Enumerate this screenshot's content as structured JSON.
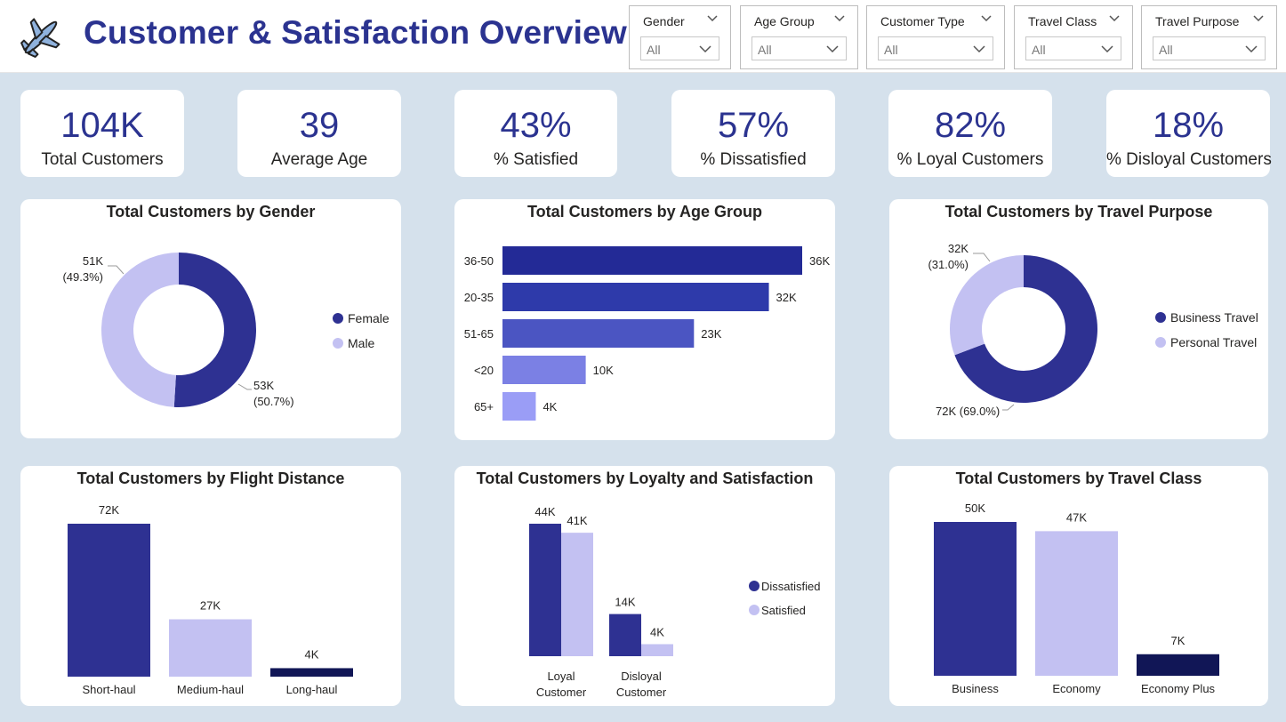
{
  "header": {
    "title": "Customer & Satisfaction Overview",
    "logo_icon": "airplane-icon"
  },
  "filters": [
    {
      "label": "Gender",
      "value": "All"
    },
    {
      "label": "Age Group",
      "value": "All"
    },
    {
      "label": "Customer Type",
      "value": "All"
    },
    {
      "label": "Travel Class",
      "value": "All"
    },
    {
      "label": "Travel Purpose",
      "value": "All"
    }
  ],
  "kpis": [
    {
      "value": "104K",
      "label": "Total Customers"
    },
    {
      "value": "39",
      "label": "Average Age"
    },
    {
      "value": "43%",
      "label": "% Satisfied"
    },
    {
      "value": "57%",
      "label": "% Dissatisfied"
    },
    {
      "value": "82%",
      "label": "% Loyal Customers"
    },
    {
      "value": "18%",
      "label": "% Disloyal Customers"
    }
  ],
  "colors": {
    "dark": "#2e3192",
    "light": "#c3c1f2",
    "navy": "#111656",
    "accent": "#2b3390"
  },
  "chart_data": [
    {
      "id": "gender",
      "type": "pie",
      "title": "Total Customers by Gender",
      "legend": "right",
      "slices": [
        {
          "name": "Female",
          "value": 53,
          "label": "53K",
          "pct": "(50.7%)",
          "color": "#2e3192"
        },
        {
          "name": "Male",
          "value": 51,
          "label": "51K",
          "pct": "(49.3%)",
          "color": "#c3c1f2"
        }
      ]
    },
    {
      "id": "age",
      "type": "bar",
      "orientation": "horizontal",
      "title": "Total Customers by Age Group",
      "categories": [
        "36-50",
        "20-35",
        "51-65",
        "<20",
        "65+"
      ],
      "values": [
        36,
        32,
        23,
        10,
        4
      ],
      "labels": [
        "36K",
        "32K",
        "23K",
        "10K",
        "4K"
      ],
      "colors": [
        "#232a96",
        "#2e3aaa",
        "#4b55c2",
        "#7b80e4",
        "#9a9df6"
      ]
    },
    {
      "id": "purpose",
      "type": "pie",
      "title": "Total Customers by Travel Purpose",
      "legend": "right",
      "slices": [
        {
          "name": "Business Travel",
          "value": 72,
          "label": "72K",
          "pct": "(69.0%)",
          "color": "#2e3192"
        },
        {
          "name": "Personal Travel",
          "value": 32,
          "label": "32K",
          "pct": "(31.0%)",
          "color": "#c3c1f2"
        }
      ]
    },
    {
      "id": "distance",
      "type": "bar",
      "title": "Total Customers by Flight Distance",
      "categories": [
        "Short-haul",
        "Medium-haul",
        "Long-haul"
      ],
      "values": [
        72,
        27,
        4
      ],
      "labels": [
        "72K",
        "27K",
        "4K"
      ],
      "colors": [
        "#2e3192",
        "#c3c1f2",
        "#111656"
      ]
    },
    {
      "id": "loyalty",
      "type": "bar",
      "title": "Total Customers by Loyalty and Satisfaction",
      "legend": "right",
      "categories": [
        [
          "Loyal",
          "Customer"
        ],
        [
          "Disloyal",
          "Customer"
        ]
      ],
      "series": [
        {
          "name": "Dissatisfied",
          "values": [
            44,
            14
          ],
          "labels": [
            "44K",
            "14K"
          ],
          "color": "#2e3192"
        },
        {
          "name": "Satisfied",
          "values": [
            41,
            4
          ],
          "labels": [
            "41K",
            "4K"
          ],
          "color": "#c3c1f2"
        }
      ]
    },
    {
      "id": "class",
      "type": "bar",
      "title": "Total Customers by Travel Class",
      "categories": [
        "Business",
        "Economy",
        "Economy Plus"
      ],
      "values": [
        50,
        47,
        7
      ],
      "labels": [
        "50K",
        "47K",
        "7K"
      ],
      "colors": [
        "#2e3192",
        "#c3c1f2",
        "#111656"
      ]
    }
  ]
}
